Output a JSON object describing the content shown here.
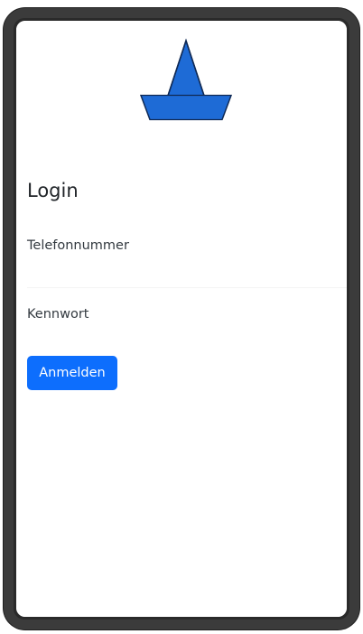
{
  "login": {
    "title": "Login",
    "phone_label": "Telefonnummer",
    "phone_value": "",
    "password_label": "Kennwort",
    "password_value": "",
    "submit_label": "Anmelden"
  },
  "colors": {
    "primary": "#0d6efd",
    "logo_sail": "#1e6bd6",
    "logo_sail_light": "#4aa3d8",
    "logo_hull": "#1e6bd6"
  },
  "icons": {
    "logo": "sailboat-icon"
  }
}
